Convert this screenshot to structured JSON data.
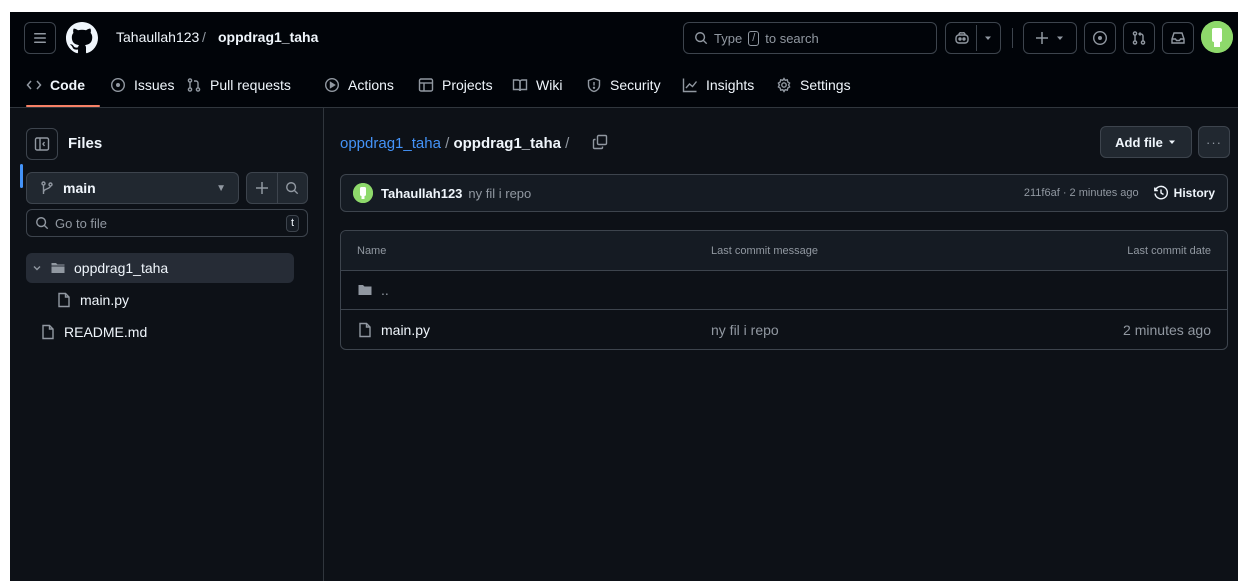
{
  "header": {
    "owner": "Tahaullah123",
    "separator": "/",
    "repo": "oppdrag1_taha",
    "search_prefix": "Type",
    "search_key": "/",
    "search_suffix": "to search"
  },
  "tabs": [
    {
      "label": "Code",
      "icon": "code-icon",
      "active": true
    },
    {
      "label": "Issues",
      "icon": "issue-icon"
    },
    {
      "label": "Pull requests",
      "icon": "pull-request-icon"
    },
    {
      "label": "Actions",
      "icon": "play-icon"
    },
    {
      "label": "Projects",
      "icon": "table-icon"
    },
    {
      "label": "Wiki",
      "icon": "book-icon"
    },
    {
      "label": "Security",
      "icon": "shield-icon"
    },
    {
      "label": "Insights",
      "icon": "graph-icon"
    },
    {
      "label": "Settings",
      "icon": "gear-icon"
    }
  ],
  "sidebar": {
    "title": "Files",
    "branch": "main",
    "goto_placeholder": "Go to file",
    "goto_key": "t",
    "tree": [
      {
        "label": "oppdrag1_taha",
        "type": "folder",
        "expanded": true,
        "selected": true
      },
      {
        "label": "main.py",
        "type": "file",
        "indent": 1
      },
      {
        "label": "README.md",
        "type": "file",
        "indent": 0
      }
    ]
  },
  "main": {
    "path_owner": "oppdrag1_taha",
    "path_sep": " / ",
    "path_current": "oppdrag1_taha",
    "path_trailing": " /",
    "add_file_label": "Add file",
    "more_label": "···",
    "commit": {
      "author": "Tahaullah123",
      "message": "ny fil i repo",
      "meta": "211f6af · 2 minutes ago",
      "history_label": "History"
    },
    "table": {
      "headers": [
        "Name",
        "Last commit message",
        "Last commit date"
      ],
      "parent_label": "..",
      "rows": [
        {
          "name": "main.py",
          "message": "ny fil i repo",
          "date": "2 minutes ago"
        }
      ]
    }
  },
  "colors": {
    "bg": "#0d1117",
    "header_bg": "#010409",
    "accent_blue": "#4493f8",
    "tab_underline": "#f78166",
    "avatar_green": "#8ed96b"
  }
}
